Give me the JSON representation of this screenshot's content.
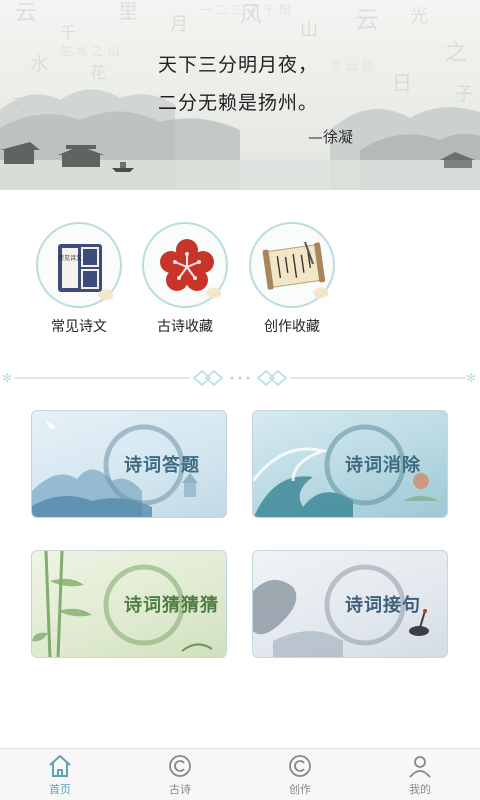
{
  "banner": {
    "poem_line_1": "天下三分明月夜，",
    "poem_line_2": "二分无赖是扬州。",
    "author": "—徐凝"
  },
  "features": [
    {
      "label": "常见诗文",
      "icon": "book-icon"
    },
    {
      "label": "古诗收藏",
      "icon": "plum-blossom-icon"
    },
    {
      "label": "创作收藏",
      "icon": "scroll-icon"
    }
  ],
  "book_cover_text": "常见诗文",
  "cards": [
    {
      "title": "诗词答题"
    },
    {
      "title": "诗词消除"
    },
    {
      "title": "诗词猜猜猜"
    },
    {
      "title": "诗词接句"
    }
  ],
  "tabs": [
    {
      "label": "首页",
      "icon": "home-icon",
      "active": true
    },
    {
      "label": "古诗",
      "icon": "copyright-icon",
      "active": false
    },
    {
      "label": "创作",
      "icon": "copyright-icon",
      "active": false
    },
    {
      "label": "我的",
      "icon": "user-icon",
      "active": false
    }
  ],
  "colors": {
    "accent": "#5fa3ad",
    "tab_inactive": "#888888",
    "circle_border": "#b8dde0"
  }
}
